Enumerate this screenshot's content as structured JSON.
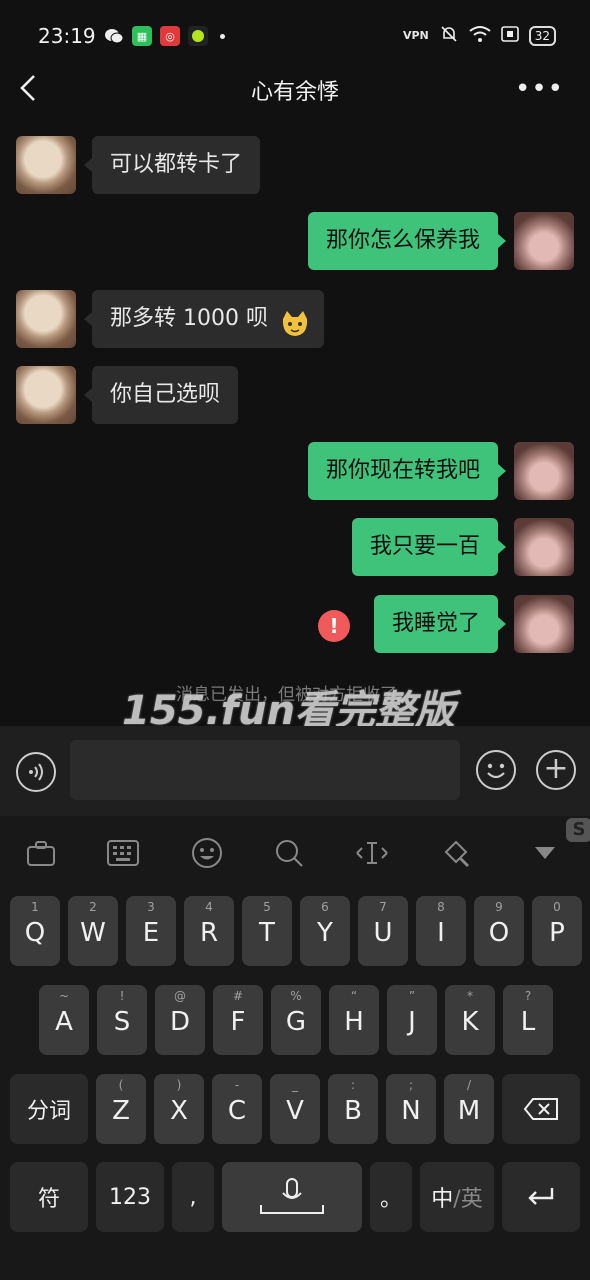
{
  "status_bar": {
    "time": "23:19",
    "vpn": "VPN",
    "battery": "32"
  },
  "nav": {
    "title": "心有余悸",
    "more": "•••"
  },
  "messages": [
    {
      "side": "in",
      "text": "可以都转卡了"
    },
    {
      "side": "out",
      "text": "那你怎么保养我"
    },
    {
      "side": "in",
      "text": "那多转 1000 呗"
    },
    {
      "side": "in",
      "text": "你自己选呗"
    },
    {
      "side": "out",
      "text": "那你现在转我吧"
    },
    {
      "side": "out",
      "text": "我只要一百"
    },
    {
      "side": "out",
      "text": "我睡觉了",
      "error": "!"
    }
  ],
  "system_note": "消息已发出，但被对方拒收了。",
  "watermark": "155.fun看完整版",
  "keyboard": {
    "row1": [
      {
        "hint": "1",
        "key": "Q"
      },
      {
        "hint": "2",
        "key": "W"
      },
      {
        "hint": "3",
        "key": "E"
      },
      {
        "hint": "4",
        "key": "R"
      },
      {
        "hint": "5",
        "key": "T"
      },
      {
        "hint": "6",
        "key": "Y"
      },
      {
        "hint": "7",
        "key": "U"
      },
      {
        "hint": "8",
        "key": "I"
      },
      {
        "hint": "9",
        "key": "O"
      },
      {
        "hint": "0",
        "key": "P"
      }
    ],
    "row2": [
      {
        "hint": "~",
        "key": "A"
      },
      {
        "hint": "!",
        "key": "S"
      },
      {
        "hint": "@",
        "key": "D"
      },
      {
        "hint": "#",
        "key": "F"
      },
      {
        "hint": "%",
        "key": "G"
      },
      {
        "hint": "“",
        "key": "H"
      },
      {
        "hint": "”",
        "key": "J"
      },
      {
        "hint": "*",
        "key": "K"
      },
      {
        "hint": "?",
        "key": "L"
      }
    ],
    "row3": [
      {
        "hint": "(",
        "key": "Z"
      },
      {
        "hint": ")",
        "key": "X"
      },
      {
        "hint": "-",
        "key": "C"
      },
      {
        "hint": "_",
        "key": "V"
      },
      {
        "hint": ":",
        "key": "B"
      },
      {
        "hint": ";",
        "key": "N"
      },
      {
        "hint": "/",
        "key": "M"
      }
    ],
    "fenci": "分词",
    "symbols": "符",
    "numbers": "123",
    "comma": ",",
    "period": "。",
    "lang_zh": "中",
    "lang_en": "/英"
  }
}
